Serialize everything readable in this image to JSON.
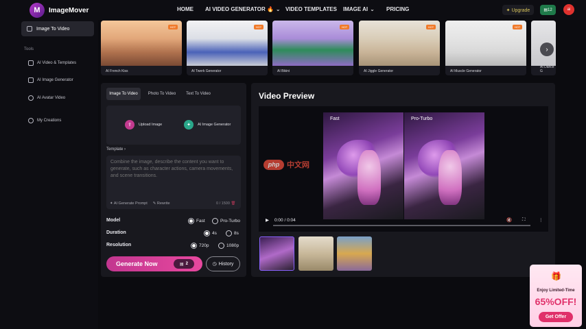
{
  "brand": {
    "name": "ImageMover",
    "logo_letter": "M"
  },
  "nav": {
    "items": [
      "HOME",
      "AI VIDEO GENERATOR 🔥",
      "VIDEO TEMPLATES",
      "IMAGE AI",
      "PRICING"
    ],
    "upgrade": "✦ Upgrade",
    "credits": "12",
    "avatar": "ai"
  },
  "sidebar": {
    "active": "Image To Video",
    "section": "Tools",
    "items": [
      "AI Video & Templates",
      "AI Image Generator",
      "AI Avatar Video",
      "My Creations"
    ]
  },
  "carousel": {
    "cards": [
      {
        "caption": "AI French Kiss",
        "badge": "HOT"
      },
      {
        "caption": "AI Twerk Generator",
        "badge": "HOT"
      },
      {
        "caption": "AI Bikini",
        "badge": "HOT"
      },
      {
        "caption": "AI Jiggle Generator",
        "badge": "HOT"
      },
      {
        "caption": "AI Muscle Generator",
        "badge": "HOT"
      },
      {
        "caption": "AI Dance G"
      }
    ]
  },
  "form": {
    "tabs": [
      "Image To Video",
      "Photo To Video",
      "Text To Video"
    ],
    "upload_image": "Upload Image",
    "ai_image_generator": "AI Image Generator",
    "template_label": "Template  ›",
    "prompt_placeholder": "Combine the image, describe the content you want to generate, such as character actions, camera movements, and scene transitions.",
    "ai_prompt": "✦ AI Generate Prompt",
    "rewrite": "✎ Rewrite",
    "counter": "0 / 1500",
    "model_label": "Model",
    "model_options": [
      "Fast",
      "Pro-Turbo"
    ],
    "duration_label": "Duration",
    "duration_options": [
      "4s",
      "8s"
    ],
    "resolution_label": "Resolution",
    "resolution_options": [
      "720p",
      "1080p"
    ],
    "generate": "Generate Now",
    "generate_cost": "2",
    "history": "History"
  },
  "preview": {
    "title": "Video Preview",
    "left_label": "Fast",
    "right_label": "Pro-Turbo",
    "time": "0:00 / 0:04"
  },
  "promo": {
    "line1": "Enjoy Limited-Time",
    "line2": "65%OFF!",
    "button": "Get Offer"
  },
  "watermark": {
    "pill": "php",
    "text": "中文网"
  }
}
